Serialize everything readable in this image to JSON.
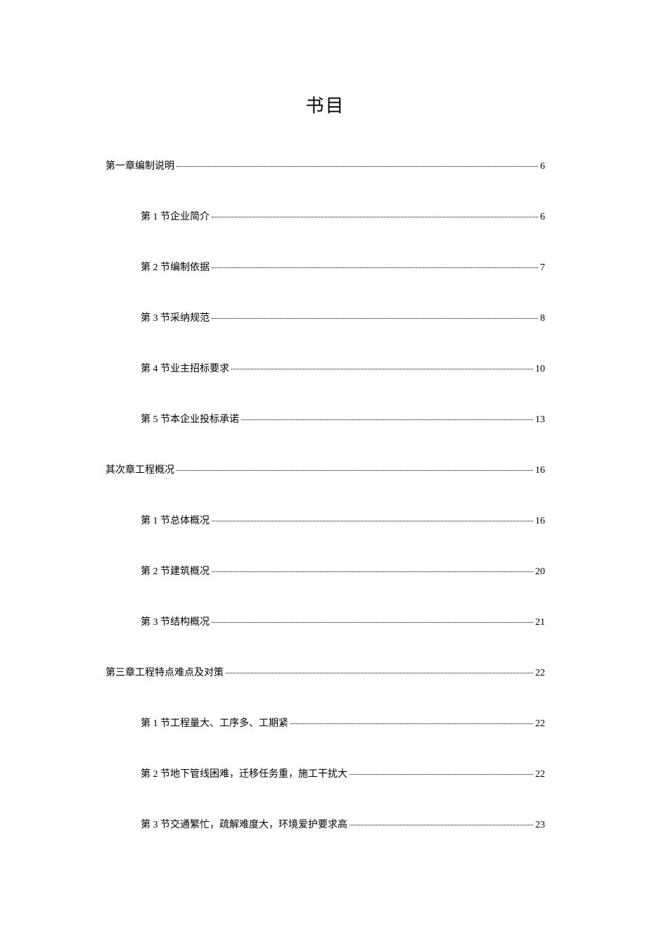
{
  "title": "书目",
  "entries": [
    {
      "level": 0,
      "label": "第一章编制说明",
      "page": "6"
    },
    {
      "level": 1,
      "label": "第 1 节企业简介",
      "page": "6"
    },
    {
      "level": 1,
      "label": "第 2 节编制依据",
      "page": "7"
    },
    {
      "level": 1,
      "label": "第 3 节采纳规范",
      "page": "8"
    },
    {
      "level": 1,
      "label": "第 4 节业主招标要求",
      "page": "10"
    },
    {
      "level": 1,
      "label": "第 5 节本企业投标承诺",
      "page": "13"
    },
    {
      "level": 0,
      "label": "其次章工程概况",
      "page": "16"
    },
    {
      "level": 1,
      "label": "第 1 节总体概况",
      "page": "16"
    },
    {
      "level": 1,
      "label": "第 2 节建筑概况",
      "page": "20"
    },
    {
      "level": 1,
      "label": "第 3 节结构概况",
      "page": "21"
    },
    {
      "level": 0,
      "label": "第三章工程特点难点及对策",
      "page": "22"
    },
    {
      "level": 1,
      "label": "第 1 节工程量大、工序多、工期紧",
      "page": "22"
    },
    {
      "level": 1,
      "label": "第 2 节地下管线困难，迁移任务重，施工干扰大",
      "page": "22"
    },
    {
      "level": 1,
      "label": "第 3 节交通繁忙，疏解难度大，环境爱护要求高",
      "page": "23"
    }
  ]
}
